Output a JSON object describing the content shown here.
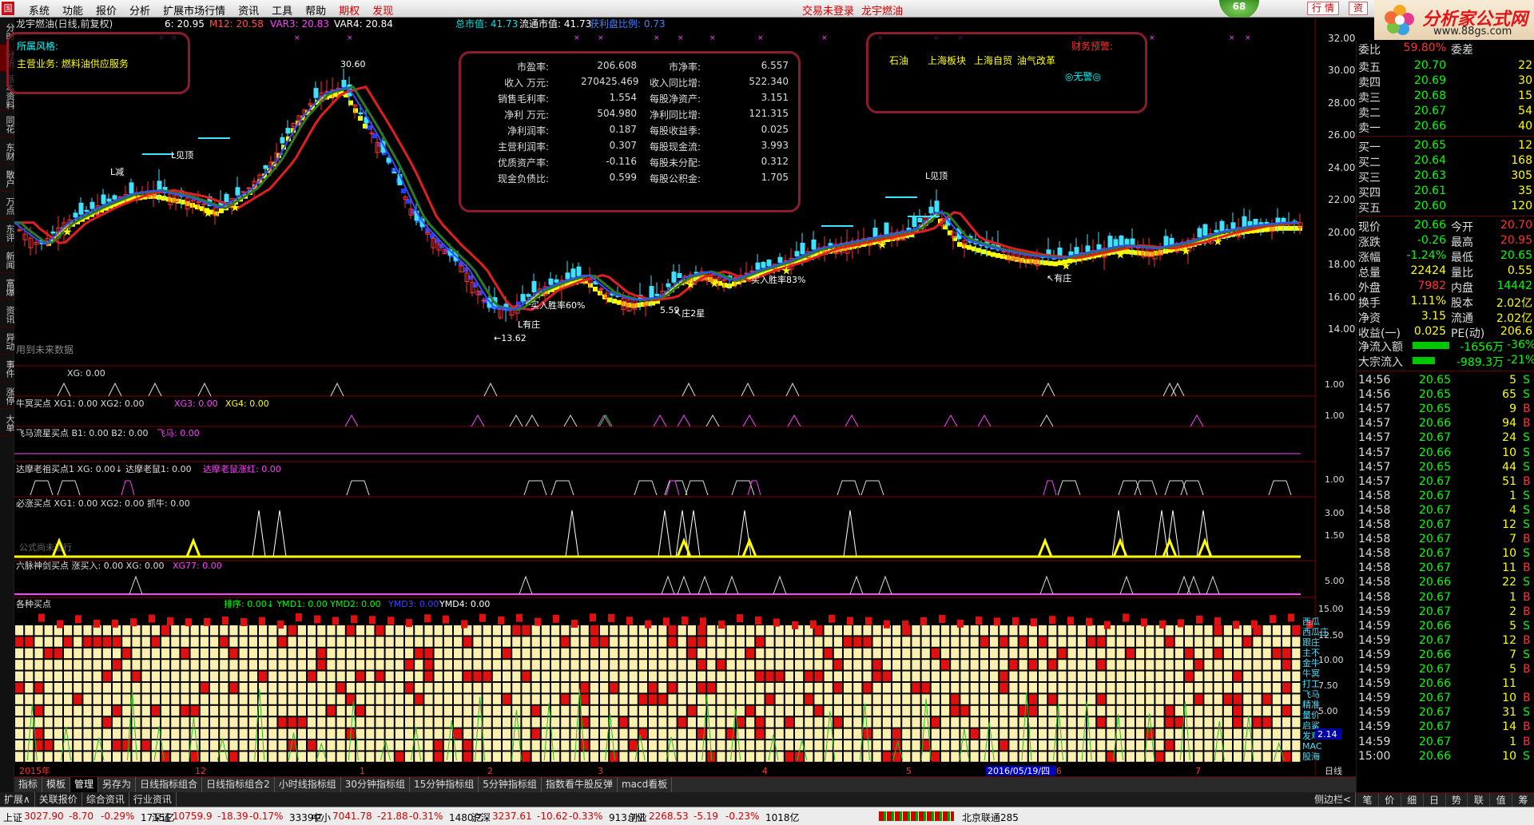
{
  "menu": {
    "logo": "国",
    "items": [
      "系统",
      "功能",
      "报价",
      "分析",
      "扩展市场行情",
      "资讯",
      "工具",
      "帮助"
    ],
    "red_items": [
      "期权",
      "发现"
    ],
    "login_status": "交易未登录",
    "stock_name": "龙宇燃油",
    "btn_quote": "行 情",
    "btn_info": "资",
    "badge": "68"
  },
  "brand": {
    "title": "分析家公式网",
    "url": "www.88gs.com"
  },
  "left_tabs": [
    "分时",
    "分析",
    "基本资料",
    "同花",
    "东财",
    "散户",
    "万点",
    "东评",
    "新闻",
    "富爆",
    "资讯",
    "异动",
    "事件",
    "涨停",
    "大单"
  ],
  "main_chart": {
    "title": "龙宇燃油(日线,前复权)",
    "indicators": [
      {
        "label": "6: 20.95",
        "color": "#ffffff"
      },
      {
        "label": "M12: 20.58",
        "color": "#ff5050"
      },
      {
        "label": "VAR3: 20.83",
        "color": "#ff40ff"
      },
      {
        "label": "VAR4: 20.84",
        "color": "#ffffff"
      }
    ],
    "market_value": "总市值: 41.73",
    "float_value": "流通市值: 41.73",
    "extra": "获利盘比例: 0.73",
    "future_note": "用到未来数据",
    "y_ticks": [
      "32.00",
      "30.00",
      "28.00",
      "26.00",
      "24.00",
      "22.00",
      "20.00",
      "18.00",
      "16.00",
      "14.00"
    ],
    "high_label": "30.60",
    "low_label": "←13.62",
    "annotations": [
      "L减",
      "L见顶",
      "L有庄",
      "买入胜率60%",
      "买入胜率83%",
      "↖庄2星",
      "5.59",
      "↖有庄"
    ],
    "box1": {
      "line1": "所属风格:",
      "line2": "主营业务: 燃料油供应服务"
    },
    "box3": {
      "tags": [
        "石油",
        "上海板块",
        "上海自贸",
        "油气改革"
      ],
      "note": "财务预警:",
      "warning": "◎无警◎"
    },
    "financials": [
      [
        "市盈率:",
        "206.608",
        "市净率:",
        "6.557"
      ],
      [
        "收入 万元:",
        "270425.469",
        "收入同比增:",
        "522.340"
      ],
      [
        "销售毛利率:",
        "1.554",
        "每股净资产:",
        "3.151"
      ],
      [
        "净利 万元:",
        "504.980",
        "净利同比增:",
        "121.315"
      ],
      [
        "净利润率:",
        "0.187",
        "每股收益季:",
        "0.025"
      ],
      [
        "主营利润率:",
        "0.307",
        "每股现金流:",
        "3.993"
      ],
      [
        "优质资产率:",
        "-0.116",
        "每股未分配:",
        "0.312"
      ],
      [
        "现金负债比:",
        "0.599",
        "每股公积金:",
        "1.705"
      ]
    ]
  },
  "sub_panels": [
    {
      "title": "XG: 0.00",
      "y": "1.00"
    },
    {
      "title": "牛冥买点 XG1: 0.00 XG2: 0.00",
      "extra": "XG3: 0.00",
      "extra2": "XG4: 0.00",
      "y": "1.00"
    },
    {
      "title": "飞马流星买点 B1: 0.00 B2: 0.00",
      "extra": "飞马: 0.00",
      "y": ""
    },
    {
      "title": "达摩老祖买点1 XG: 0.00↓ 达摩老鼠1: 0.00",
      "extra": "达摩老鼠涨红: 0.00",
      "y": "1.00"
    },
    {
      "title": "必涨买点 XG1: 0.00 XG2: 0.00 抓牛: 0.00",
      "extra": "公式尚未运行",
      "y": "3.00",
      "y2": "1.50"
    },
    {
      "title": "六脉神剑买点 涨买入: 0.00 XG: 0.00",
      "extra": "XG77: 0.00",
      "y": "5.00"
    },
    {
      "title": "各种买点",
      "extra": "排序: 0.00↓ YMD1: 0.00 YMD2: 0.00",
      "extra2": "YMD3: 0.00",
      "extra3": "YMD4: 0.00",
      "y": "15.00",
      "y2": "12.50",
      "y3": "10.00",
      "y4": "7.50",
      "y5": "5.00",
      "y6": "2.50",
      "tag": "2.14"
    }
  ],
  "grid_labels": [
    "西瓜",
    "西瓜庄",
    "跟庄",
    "主不",
    "金牛",
    "牛冥",
    "打工",
    "飞马",
    "精准",
    "量价",
    "启鲨",
    "发鸡",
    "MAC",
    "股海"
  ],
  "x_axis": {
    "labels": [
      "2015年",
      "12",
      "1",
      "2",
      "3",
      "4",
      "5",
      "2016/05/19/四",
      "6",
      "7"
    ],
    "mode": "日线"
  },
  "bottom_tabs": [
    "指标",
    "模板",
    "管理",
    "另存为",
    "日线指标组合",
    "日线指标组合2",
    "小时线指标组",
    "30分钟指标组",
    "15分钟指标组",
    "5分钟指标组",
    "指数看牛股反弹",
    "macd看板"
  ],
  "bottom_tabs2": [
    "扩展∧",
    "关联报价",
    "综合资讯",
    "行业资讯"
  ],
  "quote": {
    "ratio": {
      "label": "委比",
      "value": "59.80%",
      "label2": "委差"
    },
    "sells": [
      [
        "卖五",
        "20.70",
        "22"
      ],
      [
        "卖四",
        "20.69",
        "30"
      ],
      [
        "卖三",
        "20.68",
        "15"
      ],
      [
        "卖二",
        "20.67",
        "54"
      ],
      [
        "卖一",
        "20.66",
        "40"
      ]
    ],
    "buys": [
      [
        "买一",
        "20.65",
        "12"
      ],
      [
        "买二",
        "20.64",
        "168"
      ],
      [
        "买三",
        "20.63",
        "305"
      ],
      [
        "买四",
        "20.61",
        "35"
      ],
      [
        "买五",
        "20.60",
        "120"
      ]
    ],
    "stats": [
      [
        "现价",
        "20.66",
        "今开",
        "20.70"
      ],
      [
        "涨跌",
        "-0.26",
        "最高",
        "20.95"
      ],
      [
        "涨幅",
        "-1.24%",
        "最低",
        "20.65"
      ],
      [
        "总量",
        "22424",
        "量比",
        "0.55"
      ],
      [
        "外盘",
        "7982",
        "内盘",
        "14442"
      ],
      [
        "换手",
        "1.11%",
        "股本",
        "2.02亿"
      ],
      [
        "净资",
        "3.15",
        "流通",
        "2.02亿"
      ],
      [
        "收益(一)",
        "0.025",
        "PE(动)",
        "206.6"
      ]
    ],
    "flows": [
      [
        "净流入额",
        "-1656万",
        "-36%"
      ],
      [
        "大宗流入",
        "-989.3万",
        "-21%"
      ]
    ],
    "ticks": [
      [
        "14:56",
        "20.65",
        "5",
        "S"
      ],
      [
        "14:56",
        "20.65",
        "65",
        "S"
      ],
      [
        "14:57",
        "20.65",
        "9",
        "B"
      ],
      [
        "14:57",
        "20.66",
        "94",
        "B"
      ],
      [
        "14:57",
        "20.67",
        "24",
        "S"
      ],
      [
        "14:57",
        "20.66",
        "10",
        "S"
      ],
      [
        "14:57",
        "20.65",
        "44",
        "S"
      ],
      [
        "14:57",
        "20.67",
        "51",
        "B"
      ],
      [
        "14:58",
        "20.67",
        "1",
        "S"
      ],
      [
        "14:58",
        "20.67",
        "4",
        "S"
      ],
      [
        "14:58",
        "20.67",
        "12",
        "S"
      ],
      [
        "14:58",
        "20.67",
        "7",
        "B"
      ],
      [
        "14:58",
        "20.67",
        "10",
        "S"
      ],
      [
        "14:58",
        "20.67",
        "11",
        "B"
      ],
      [
        "14:58",
        "20.66",
        "22",
        "S"
      ],
      [
        "14:58",
        "20.67",
        "1",
        "B"
      ],
      [
        "14:59",
        "20.67",
        "2",
        "B"
      ],
      [
        "14:59",
        "20.66",
        "5",
        "S"
      ],
      [
        "14:59",
        "20.67",
        "12",
        "B"
      ],
      [
        "14:59",
        "20.66",
        "7",
        "S"
      ],
      [
        "14:59",
        "20.67",
        "5",
        "B"
      ],
      [
        "14:59",
        "20.66",
        "11",
        ""
      ],
      [
        "14:59",
        "20.67",
        "10",
        "B"
      ],
      [
        "14:59",
        "20.67",
        "31",
        "S"
      ],
      [
        "14:59",
        "20.67",
        "14",
        "B"
      ],
      [
        "14:59",
        "20.67",
        "1",
        "B"
      ],
      [
        "15:00",
        "20.66",
        "10",
        "S"
      ]
    ],
    "bottom_tabs": [
      "笔",
      "价",
      "细",
      "日",
      "势",
      "联",
      "值",
      "筹"
    ],
    "side_label": "侧边栏<"
  },
  "statusbar": [
    {
      "name": "上证",
      "value": "3027.90",
      "chg": "-8.70",
      "pct": "-0.29%",
      "vol": "1715亿"
    },
    {
      "name": "深证",
      "value": "10759.9",
      "chg": "-18.39",
      "pct": "-0.17%",
      "vol": "3339亿"
    },
    {
      "name": "中小",
      "value": "7041.78",
      "chg": "-21.88",
      "pct": "-0.31%",
      "vol": "1480亿"
    },
    {
      "name": "沪深",
      "value": "3237.61",
      "chg": "-10.62",
      "pct": "-0.33%",
      "vol": "913.7亿"
    },
    {
      "name": "创业",
      "value": "2268.53",
      "chg": "-5.19",
      "pct": "-0.23%",
      "vol": "1018亿"
    }
  ],
  "server": "北京联通285",
  "colors": {
    "up": "#ff3030",
    "down": "#40e0ff",
    "accent": "#8b1c2b",
    "yellow": "#ffff00",
    "green": "#00c800"
  }
}
